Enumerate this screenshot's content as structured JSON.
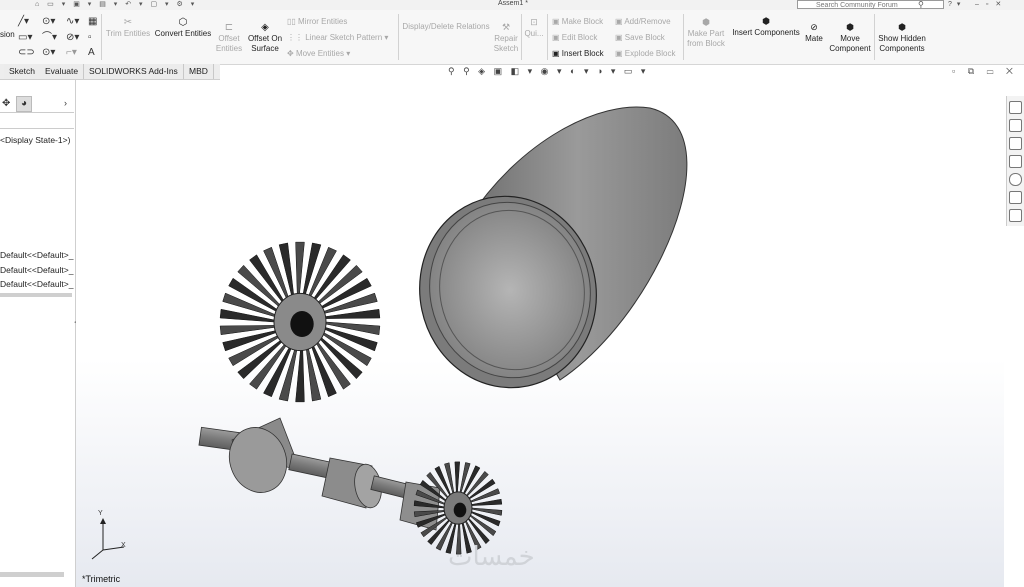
{
  "title_bar": {
    "doc_title": "Assem1 *",
    "search_placeholder": "Search Community Forum"
  },
  "ribbon": {
    "sketch_cut_label": "sion",
    "trim_entities": "Trim Entities",
    "convert_entities": "Convert Entities",
    "offset_entities": "Offset Entities",
    "offset_on_surface": "Offset On Surface",
    "mirror_entities": "Mirror Entities",
    "linear_sketch_pattern": "Linear Sketch Pattern",
    "move_entities": "Move Entities",
    "display_delete_relations": "Display/Delete Relations",
    "repair_sketch": "Repair Sketch",
    "quick_snaps": "Qui...",
    "make_block": "Make Block",
    "edit_block": "Edit Block",
    "insert_block": "Insert Block",
    "add_remove": "Add/Remove",
    "save_block": "Save Block",
    "explode_block": "Explode Block",
    "make_part_from_block": "Make Part from Block",
    "insert_components": "Insert Components",
    "mate": "Mate",
    "move_component": "Move Component",
    "show_hidden_components": "Show Hidden Components"
  },
  "tabs": [
    "Sketch",
    "Evaluate",
    "SOLIDWORKS Add-Ins",
    "MBD"
  ],
  "feature_tree": {
    "display_state": "<Display State-1>)",
    "items": [
      "Default<<Default>_",
      "Default<<Default>_",
      "Default<<Default>_"
    ]
  },
  "viewport": {
    "view_name": "*Trimetric",
    "watermark": "خمسات",
    "triad_axis_x": "X",
    "triad_axis_y": "Y"
  },
  "colors": {
    "part_gray": "#8a8a8a",
    "dark": "#1a1a1a",
    "ribbon_bg": "#f7f7f7"
  }
}
